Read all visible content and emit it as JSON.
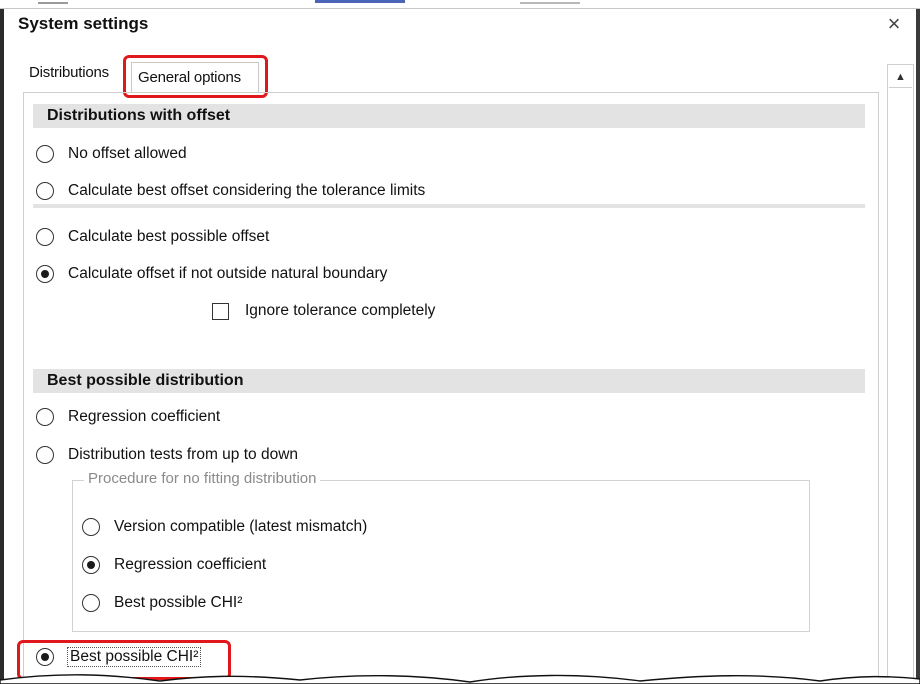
{
  "dialog": {
    "title": "System settings",
    "close_symbol": "×"
  },
  "tabs": [
    {
      "label": "Distributions",
      "selected": false
    },
    {
      "label": "General options",
      "selected": true
    }
  ],
  "section_offset": {
    "header": "Distributions with offset",
    "options": [
      {
        "label": "No offset allowed",
        "checked": false
      },
      {
        "label": "Calculate best offset considering the tolerance limits",
        "checked": false
      },
      {
        "label": "Calculate best possible offset",
        "checked": false
      },
      {
        "label": "Calculate offset if not outside natural boundary",
        "checked": true
      }
    ],
    "checkbox": {
      "label": "Ignore tolerance completely",
      "checked": false
    }
  },
  "section_best": {
    "header": "Best possible distribution",
    "options": [
      {
        "label": "Regression coefficient",
        "checked": false
      },
      {
        "label": "Distribution tests from up to down",
        "checked": false
      }
    ],
    "group": {
      "label": "Procedure for no fitting distribution",
      "options": [
        {
          "label": "Version compatible (latest mismatch)",
          "checked": false
        },
        {
          "label": "Regression coefficient",
          "checked": true
        },
        {
          "label": "Best possible CHI²",
          "checked": false
        }
      ]
    },
    "final_option": {
      "label": "Best possible CHI²",
      "checked": true
    }
  },
  "scrollbar": {
    "up_arrow_icon": "triangle-up"
  },
  "colors": {
    "highlight": "#e0181b",
    "section_header_bg": "#e3e3e3"
  }
}
